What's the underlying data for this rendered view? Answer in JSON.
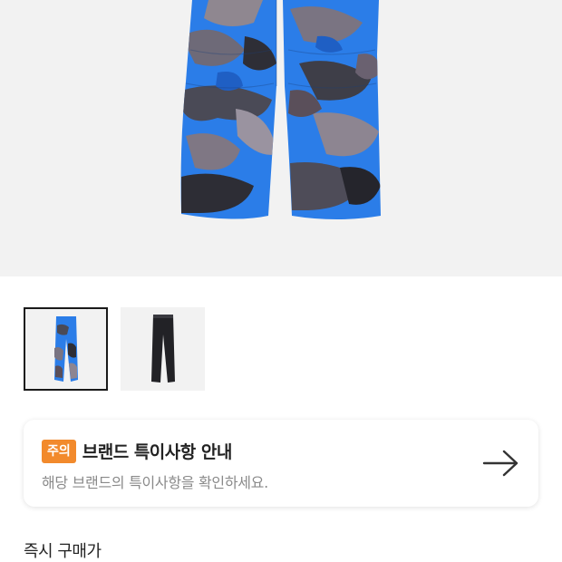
{
  "product": {
    "hero_image": "blue-camo-cargo-pants-image",
    "thumbnails": [
      {
        "name": "blue-camo-pants-thumbnail",
        "selected": true
      },
      {
        "name": "black-pants-thumbnail",
        "selected": false
      }
    ]
  },
  "notice": {
    "badge": "주의",
    "title": "브랜드 특이사항 안내",
    "subtitle": "해당 브랜드의 특이사항을 확인하세요.",
    "icon": "arrow-right-icon",
    "badge_color": "#f28a2c"
  },
  "price": {
    "label": "즉시 구매가"
  }
}
